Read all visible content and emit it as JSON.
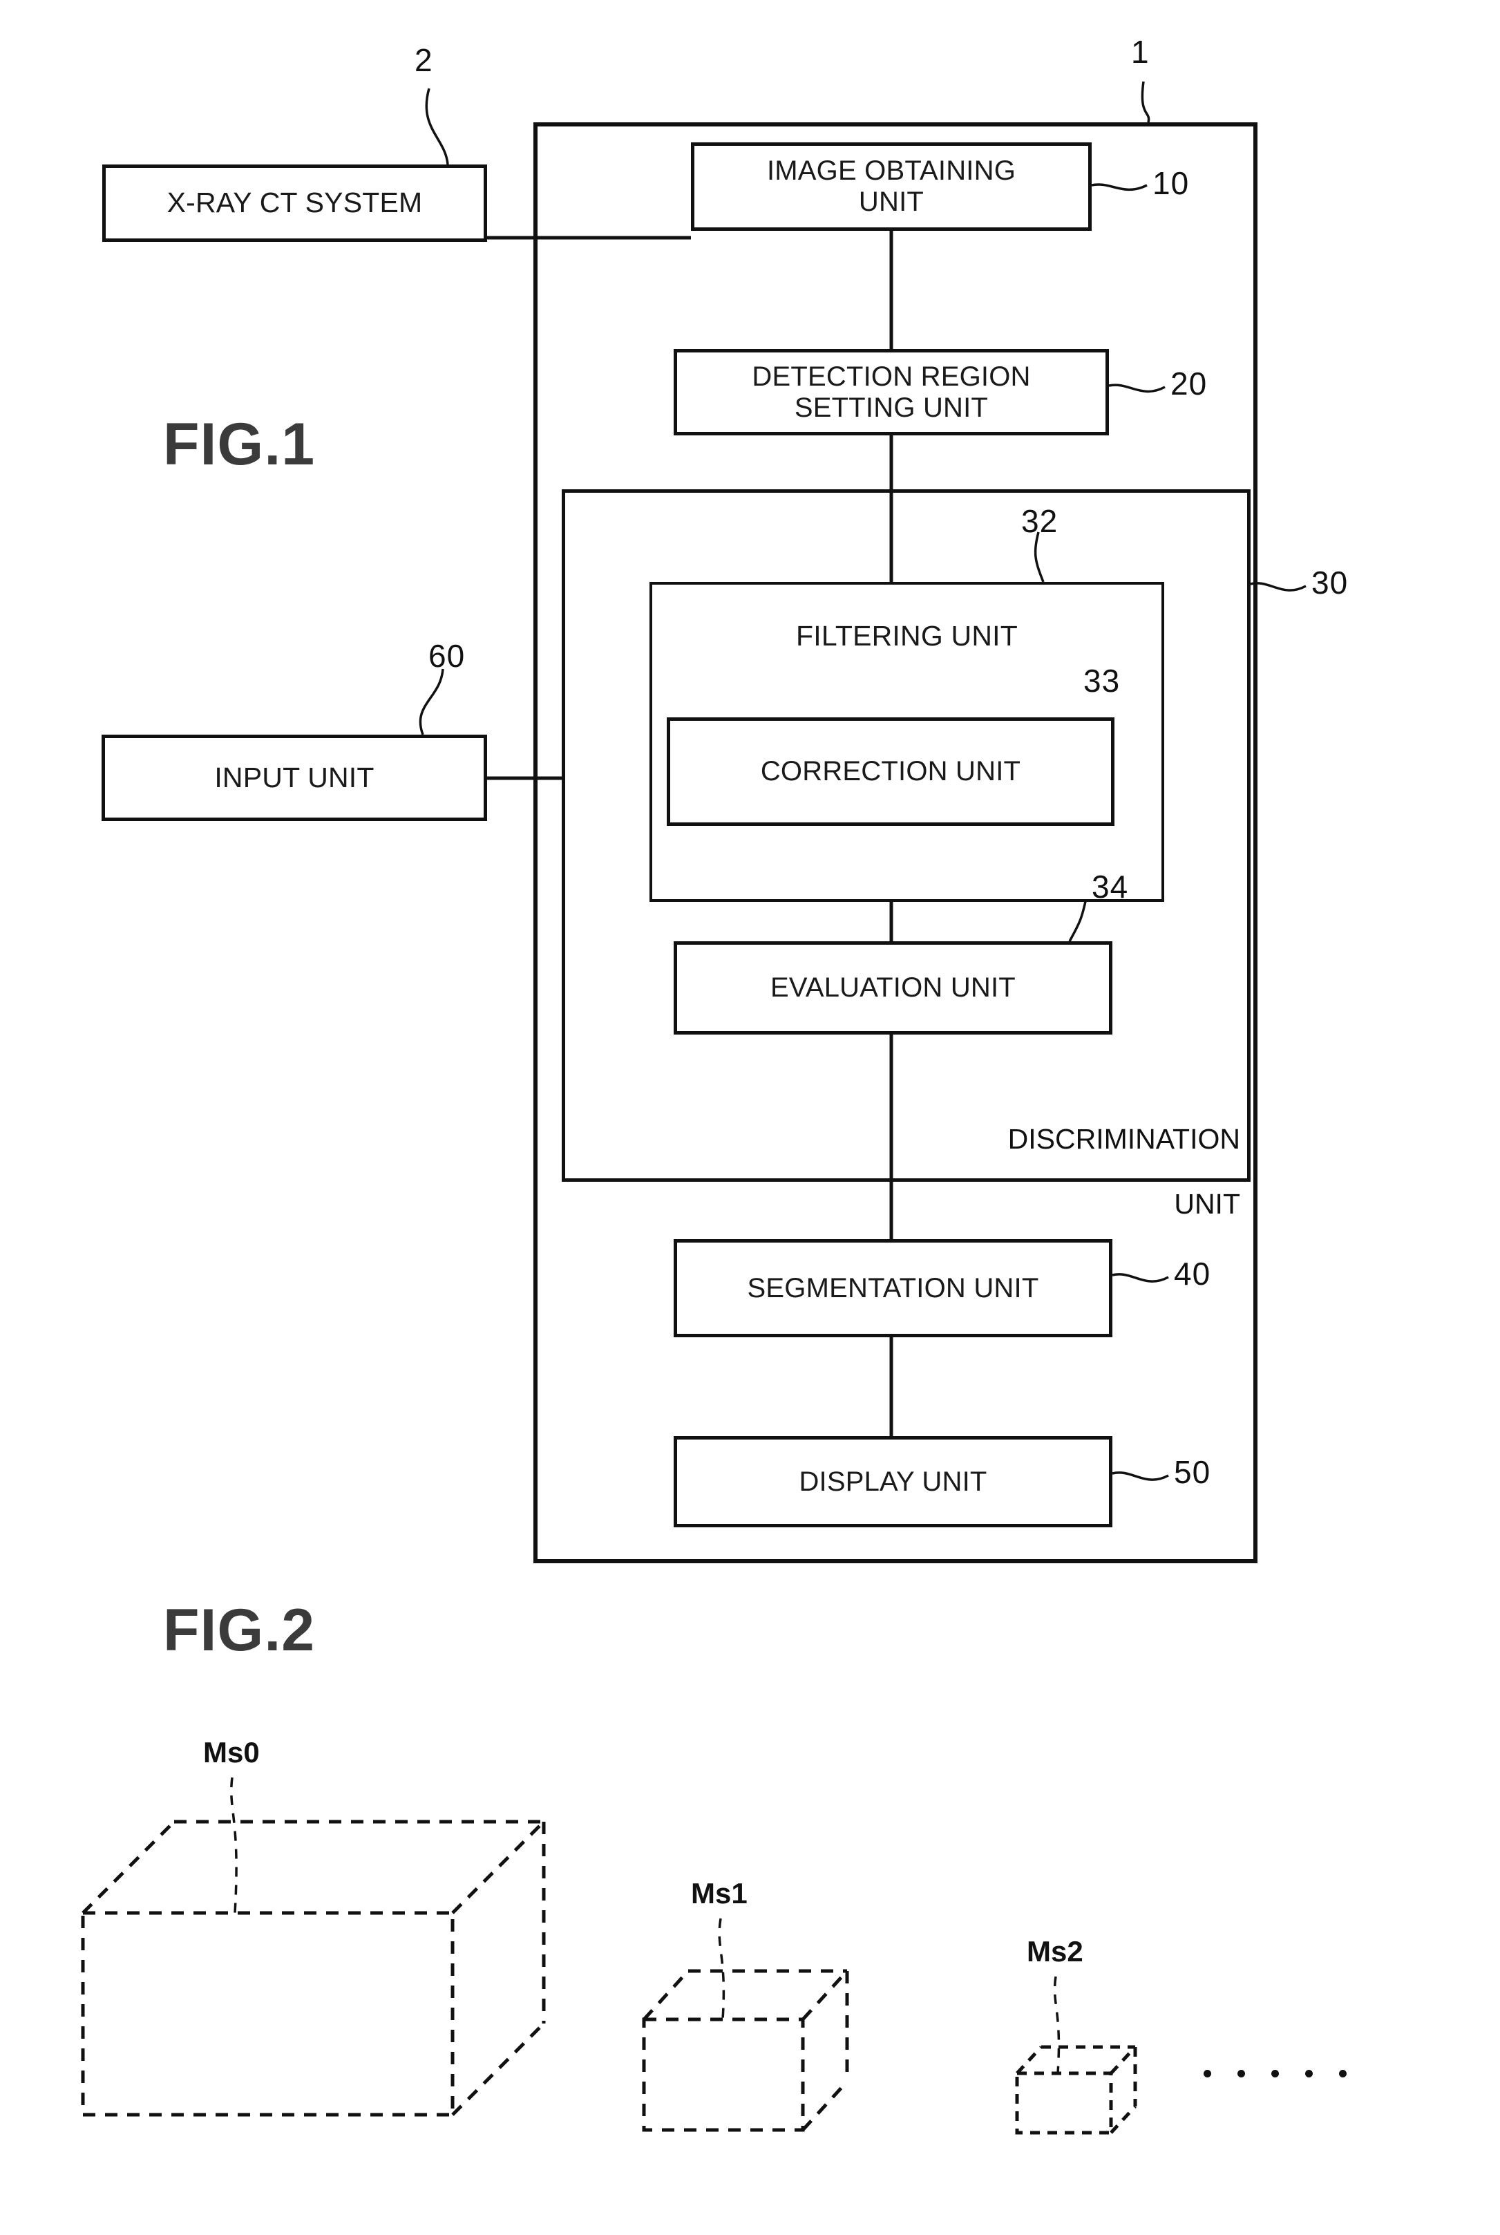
{
  "figures": [
    {
      "id": "fig1",
      "title": "FIG.1",
      "blocks": [
        {
          "key": "xray_ct_system",
          "label": "X-RAY CT SYSTEM",
          "ref": "2"
        },
        {
          "key": "image_obtaining_unit",
          "label": "IMAGE OBTAINING\nUNIT",
          "ref": "10"
        },
        {
          "key": "detection_region_setting_unit",
          "label": "DETECTION REGION\nSETTING UNIT",
          "ref": "20"
        },
        {
          "key": "discrimination_unit",
          "label": "DISCRIMINATION\nUNIT",
          "ref": "30"
        },
        {
          "key": "filtering_unit",
          "label": "FILTERING UNIT",
          "ref": "32"
        },
        {
          "key": "correction_unit",
          "label": "CORRECTION UNIT",
          "ref": "33"
        },
        {
          "key": "evaluation_unit",
          "label": "EVALUATION UNIT",
          "ref": "34"
        },
        {
          "key": "segmentation_unit",
          "label": "SEGMENTATION UNIT",
          "ref": "40"
        },
        {
          "key": "display_unit",
          "label": "DISPLAY UNIT",
          "ref": "50"
        },
        {
          "key": "input_unit",
          "label": "INPUT UNIT",
          "ref": "60"
        },
        {
          "key": "apparatus",
          "label": "",
          "ref": "1"
        }
      ]
    },
    {
      "id": "fig2",
      "title": "FIG.2",
      "items": [
        {
          "key": "ms0",
          "label": "Ms0"
        },
        {
          "key": "ms1",
          "label": "Ms1"
        },
        {
          "key": "ms2",
          "label": "Ms2"
        }
      ],
      "ellipsis_dot_count": 5
    }
  ],
  "fig1": {
    "title": "FIG.1",
    "apparatus_ref": "1",
    "xray_ct_system": {
      "label": "X-RAY CT SYSTEM",
      "ref": "2"
    },
    "image_obtaining_unit": {
      "line1": "IMAGE OBTAINING",
      "line2": "UNIT",
      "ref": "10"
    },
    "detection_region_setting_unit": {
      "line1": "DETECTION REGION",
      "line2": "SETTING UNIT",
      "ref": "20"
    },
    "discrimination_unit": {
      "line1": "DISCRIMINATION",
      "line2": "UNIT",
      "ref": "30"
    },
    "filtering_unit": {
      "label": "FILTERING UNIT",
      "ref": "32"
    },
    "correction_unit": {
      "label": "CORRECTION UNIT",
      "ref": "33"
    },
    "evaluation_unit": {
      "label": "EVALUATION UNIT",
      "ref": "34"
    },
    "segmentation_unit": {
      "label": "SEGMENTATION UNIT",
      "ref": "40"
    },
    "display_unit": {
      "label": "DISPLAY UNIT",
      "ref": "50"
    },
    "input_unit": {
      "label": "INPUT UNIT",
      "ref": "60"
    }
  },
  "fig2": {
    "title": "FIG.2",
    "ms0": {
      "label": "Ms0"
    },
    "ms1": {
      "label": "Ms1"
    },
    "ms2": {
      "label": "Ms2"
    }
  },
  "colors": {
    "line": "#111111",
    "figure_title": "#3b3b3b",
    "background": "#ffffff"
  }
}
